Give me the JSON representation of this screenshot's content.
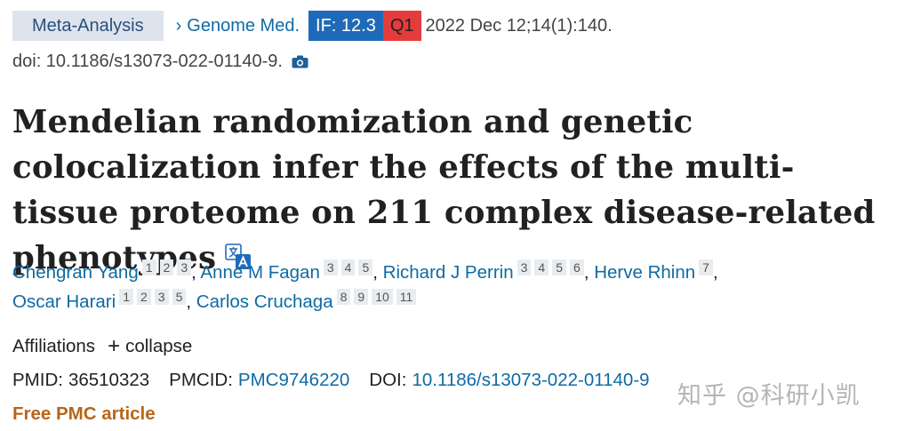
{
  "header": {
    "article_type": "Meta-Analysis",
    "journal_link": "Genome Med.",
    "impact_factor": "IF: 12.3",
    "quartile": "Q1",
    "citation": "2022 Dec 12;14(1):140.",
    "doi_line": "doi: 10.1186/s13073-022-01140-9.",
    "colors": {
      "if_badge": "#1f6ab8",
      "quartile_badge": "#e43c3c",
      "link": "#0f6aa3",
      "free_pmc": "#b8651b"
    }
  },
  "article": {
    "title": "Mendelian randomization and genetic colocalization infer the effects of the multi-tissue proteome on 211 complex disease-related phenotypes"
  },
  "authors": [
    {
      "name": "Chengran Yang",
      "affils": [
        "1",
        "2",
        "3"
      ]
    },
    {
      "name": "Anne M Fagan",
      "affils": [
        "3",
        "4",
        "5"
      ]
    },
    {
      "name": "Richard J Perrin",
      "affils": [
        "3",
        "4",
        "5",
        "6"
      ]
    },
    {
      "name": "Herve Rhinn",
      "affils": [
        "7"
      ]
    },
    {
      "name": "Oscar Harari",
      "affils": [
        "1",
        "2",
        "3",
        "5"
      ]
    },
    {
      "name": "Carlos Cruchaga",
      "affils": [
        "8",
        "9",
        "10",
        "11"
      ]
    }
  ],
  "affiliations": {
    "label": "Affiliations",
    "toggle_label": "collapse"
  },
  "ids": {
    "pmid_label": "PMID:",
    "pmid": "36510323",
    "pmcid_label": "PMCID:",
    "pmcid": "PMC9746220",
    "doi_label": "DOI:",
    "doi": "10.1186/s13073-022-01140-9"
  },
  "free_article": "Free PMC article",
  "watermark": "知乎 @科研小凯",
  "icons": {
    "journal": "chevron-right-icon",
    "doi_camera": "camera-icon",
    "translate": "translate-icon",
    "affiliations": "plus-icon"
  }
}
